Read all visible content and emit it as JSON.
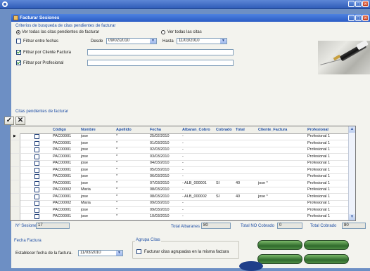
{
  "outer_window": {
    "title": ""
  },
  "window": {
    "title": "Facturar Sesiones"
  },
  "criteria": {
    "title": "Criterios de busqueda de citas pendientes de facturar",
    "radio_pending": "Ver todas las citas pendientes de facturar",
    "radio_all": "Ver todas las citas",
    "filter_dates": "Filtrar entre fechas",
    "from_label": "Desde",
    "from_value": "09/02/2010",
    "to_label": "Hasta",
    "to_value": "11/03/2010",
    "filter_client": "Filtrar por Cliente Factura",
    "filter_prof": "Filtrar por Profesional"
  },
  "grid": {
    "title": "Citas pendientes de facturar",
    "columns": [
      "Código",
      "Nombre",
      "Apellido",
      "Fecha",
      "Albaran_Cobro",
      "Cobrado",
      "Total",
      "Cliente_Factura",
      "Profesional"
    ],
    "rows": [
      [
        "PAC00001",
        "jose",
        "*",
        "25/02/2010",
        "-",
        "",
        "",
        "",
        "Profesional 1"
      ],
      [
        "PAC00001",
        "jose",
        "*",
        "01/03/2010",
        "-",
        "",
        "",
        "",
        "Profesional 1"
      ],
      [
        "PAC00001",
        "jose",
        "*",
        "02/03/2010",
        "-",
        "",
        "",
        "",
        "Profesional 1"
      ],
      [
        "PAC00001",
        "jose",
        "*",
        "03/03/2010",
        "-",
        "",
        "",
        "",
        "Profesional 1"
      ],
      [
        "PAC00001",
        "jose",
        "*",
        "04/03/2010",
        "-",
        "",
        "",
        "",
        "Profesional 1"
      ],
      [
        "PAC00001",
        "jose",
        "*",
        "05/03/2010",
        "-",
        "",
        "",
        "",
        "Profesional 1"
      ],
      [
        "PAC00001",
        "jose",
        "*",
        "06/03/2010",
        "-",
        "",
        "",
        "",
        "Profesional 1"
      ],
      [
        "PAC00001",
        "jose",
        "*",
        "07/03/2010",
        "- ALB_000001",
        "SI",
        "40",
        "jose *",
        "Profesional 1"
      ],
      [
        "PAC00002",
        "Maria",
        "*",
        "08/03/2010",
        "-",
        "",
        "",
        "",
        "Profesional 1"
      ],
      [
        "PAC00001",
        "jose",
        "*",
        "08/03/2010",
        "- ALB_000002",
        "SI",
        "40",
        "jose *",
        "Profesional 1"
      ],
      [
        "PAC00002",
        "Maria",
        "*",
        "09/03/2010",
        "-",
        "",
        "",
        "",
        "Profesional 1"
      ],
      [
        "PAC00001",
        "jose",
        "*",
        "09/03/2010",
        "-",
        "",
        "",
        "",
        "Profesional 1"
      ],
      [
        "PAC00001",
        "jose",
        "*",
        "10/03/2010",
        "-",
        "",
        "",
        "",
        "Profesional 1"
      ]
    ]
  },
  "totals": {
    "sessions_label": "Nº Sesiones",
    "sessions_value": "17",
    "albaranes_label": "Total Albaranes",
    "albaranes_value": "80",
    "no_cobrado_label": "Total NO Cobrado",
    "no_cobrado_value": "0",
    "cobrado_label": "Total Cobrado",
    "cobrado_value": "80"
  },
  "invoice_date": {
    "title": "Fecha Factura",
    "label": "Establecer fecha de la factura.",
    "value": "11/03/2010"
  },
  "group": {
    "title": "Agrupa Citas",
    "checkbox": "Facturar citas agrupadas en la misma factura"
  },
  "actions": {
    "btn1": "",
    "btn2": "",
    "btn3": "",
    "btn4": ""
  },
  "icons": {
    "accept": "✓",
    "cancel": "✕"
  },
  "colors": {
    "title_blue": "#2a5cc5",
    "label_blue": "#1f4fa5",
    "action_green": "#2f6a2c"
  }
}
